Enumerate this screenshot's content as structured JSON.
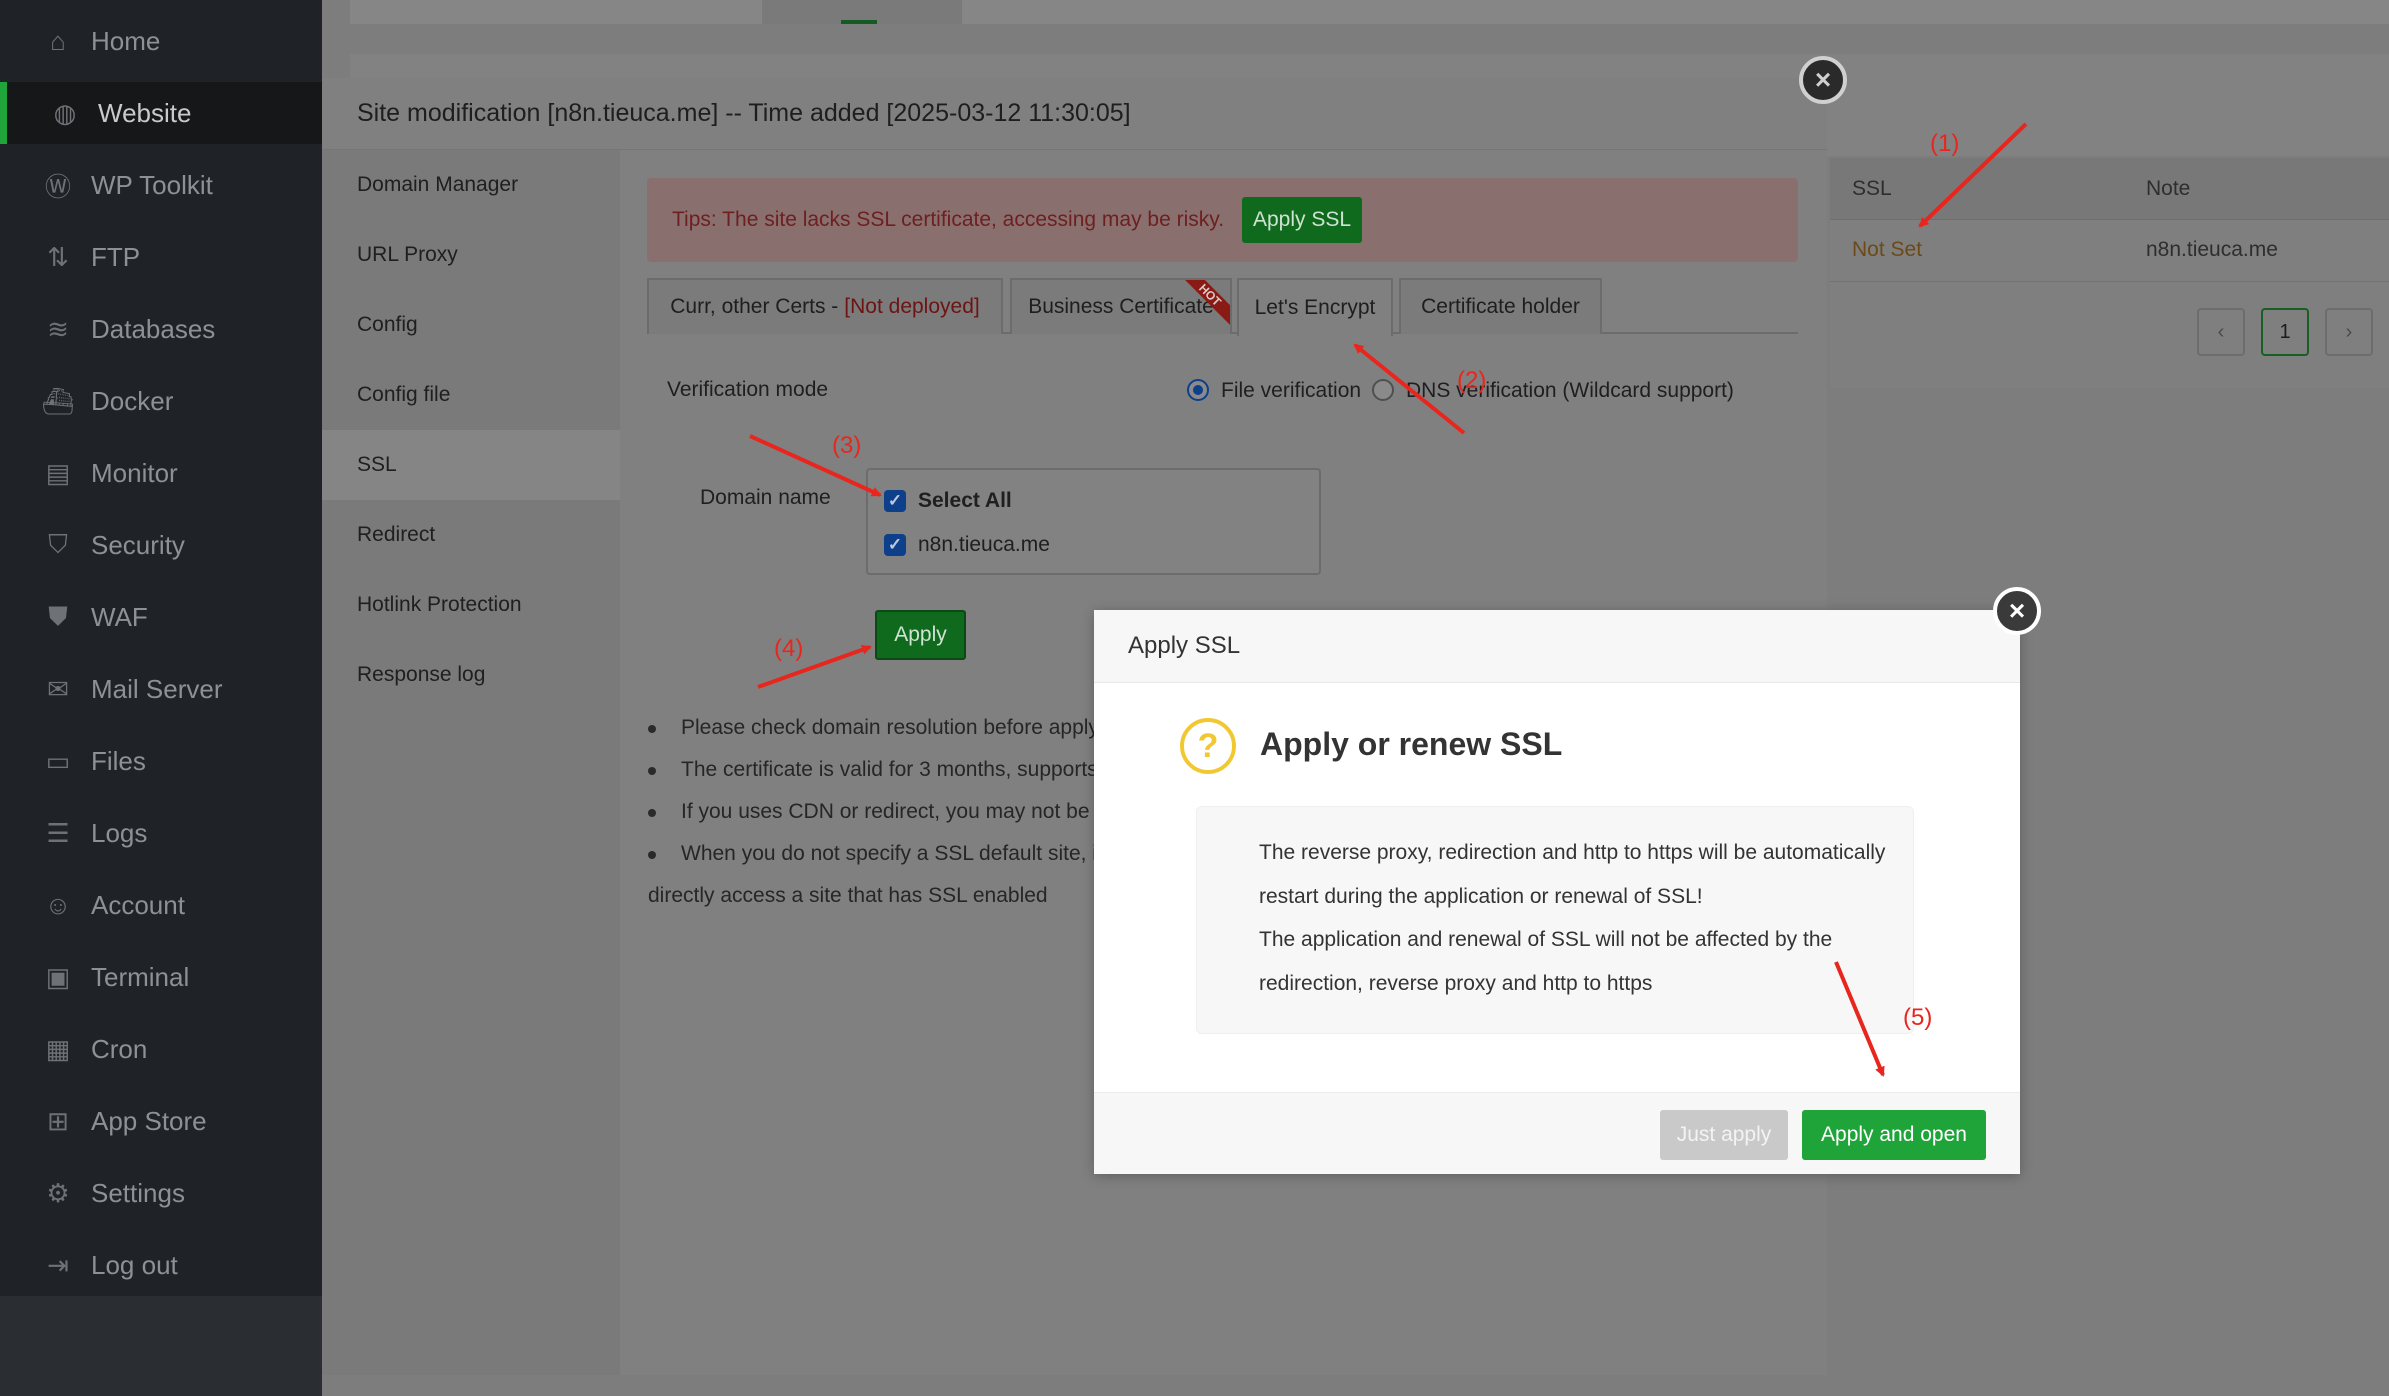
{
  "sidebar": {
    "items": [
      {
        "label": "Home",
        "icon": "home-icon",
        "glyph": "⌂"
      },
      {
        "label": "Website",
        "icon": "globe-icon",
        "glyph": "◍"
      },
      {
        "label": "WP Toolkit",
        "icon": "wordpress-icon",
        "glyph": "Ⓦ"
      },
      {
        "label": "FTP",
        "icon": "ftp-icon",
        "glyph": "⇅"
      },
      {
        "label": "Databases",
        "icon": "database-icon",
        "glyph": "≋"
      },
      {
        "label": "Docker",
        "icon": "docker-icon",
        "glyph": "⛴"
      },
      {
        "label": "Monitor",
        "icon": "monitor-icon",
        "glyph": "▤"
      },
      {
        "label": "Security",
        "icon": "shield-icon",
        "glyph": "⛉"
      },
      {
        "label": "WAF",
        "icon": "waf-shield-icon",
        "glyph": "⛊"
      },
      {
        "label": "Mail Server",
        "icon": "mail-icon",
        "glyph": "✉"
      },
      {
        "label": "Files",
        "icon": "folder-icon",
        "glyph": "▭"
      },
      {
        "label": "Logs",
        "icon": "logs-icon",
        "glyph": "☰"
      },
      {
        "label": "Account",
        "icon": "user-icon",
        "glyph": "☺"
      },
      {
        "label": "Terminal",
        "icon": "terminal-icon",
        "glyph": "▣"
      },
      {
        "label": "Cron",
        "icon": "calendar-icon",
        "glyph": "▦"
      },
      {
        "label": "App Store",
        "icon": "apps-icon",
        "glyph": "⊞"
      },
      {
        "label": "Settings",
        "icon": "gear-icon",
        "glyph": "⚙"
      },
      {
        "label": "Log out",
        "icon": "logout-icon",
        "glyph": "⇥"
      }
    ],
    "active_index": 1
  },
  "background": {
    "table": {
      "col_ssl": "SSL",
      "col_note": "Note",
      "ssl_value": "Not Set",
      "note_value": "n8n.tieuca.me"
    },
    "pager": {
      "prev": "‹",
      "page": "1",
      "next": "›"
    }
  },
  "site_modal": {
    "title": "Site modification [n8n.tieuca.me] -- Time added [2025-03-12 11:30:05]",
    "close": "×",
    "nav": [
      "Domain Manager",
      "URL Proxy",
      "Config",
      "Config file",
      "SSL",
      "Redirect",
      "Hotlink Protection",
      "Response log"
    ],
    "nav_active": "SSL",
    "tip": "Tips: The site lacks SSL certificate, accessing may be risky.",
    "apply_ssl_label": "Apply SSL",
    "tabs": {
      "curr_certs": "Curr, other Certs - ",
      "curr_status": "[Not deployed]",
      "business": "Business Certificate",
      "hot": "HOT",
      "letsencrypt": "Let's Encrypt",
      "holder": "Certificate holder"
    },
    "verification_label": "Verification mode",
    "file_verification": "File verification",
    "dns_verification": "DNS verification (Wildcard support)",
    "domain_label": "Domain name",
    "select_all": "Select All",
    "domain": "n8n.tieuca.me",
    "apply_label": "Apply",
    "notes": [
      "Please check domain resolution before apply",
      "The certificate is valid for 3 months, supports",
      "If you uses CDN or redirect, you may not be a",
      "When you do not specify a SSL default site, if"
    ],
    "notes_tail": "directly access a site that has SSL enabled"
  },
  "ssl_dialog": {
    "title": "Apply SSL",
    "close": "×",
    "heading": "Apply or renew SSL",
    "icon": "question-icon",
    "lines": [
      "The reverse proxy, redirection and http to https will be automatically",
      "restart during the application or renewal of SSL!",
      "The application and renewal of SSL will not be affected by the",
      "redirection, reverse proxy and http to https"
    ],
    "just_apply": "Just apply",
    "apply_open": "Apply and open"
  },
  "annotations": [
    "(1)",
    "(2)",
    "(3)",
    "(4)",
    "(5)"
  ],
  "colors": {
    "accent_green": "#20a53a",
    "annotation_red": "#e8261d",
    "warning_yellow": "#f2c832"
  }
}
